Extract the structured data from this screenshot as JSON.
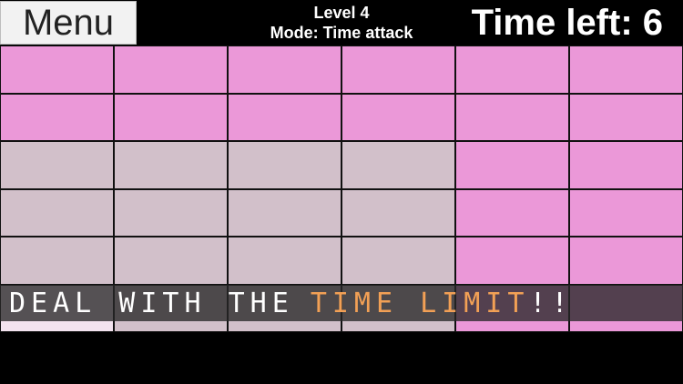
{
  "header": {
    "menu_label": "Menu",
    "level": "Level 4",
    "mode": "Mode: Time attack",
    "time_left": "Time left: 6"
  },
  "board": {
    "rows": 6,
    "cols": 6,
    "cells": [
      [
        "pink",
        "pink",
        "pink",
        "pink",
        "pink",
        "pink"
      ],
      [
        "pink",
        "pink",
        "pink",
        "pink",
        "pink",
        "pink"
      ],
      [
        "gray",
        "gray",
        "gray",
        "gray",
        "pink",
        "pink"
      ],
      [
        "gray",
        "gray",
        "gray",
        "gray",
        "pink",
        "pink"
      ],
      [
        "gray",
        "gray",
        "gray",
        "gray",
        "pink",
        "pink"
      ],
      [
        "light",
        "gray",
        "gray",
        "gray",
        "pink",
        "pink"
      ]
    ]
  },
  "banner": {
    "part1": "DEAL WITH THE",
    "part2": "TIME LIMIT",
    "part3": "!!"
  },
  "colors": {
    "pink": "#eb98d8",
    "gray": "#d2c0ca",
    "banner_highlight": "#f2a055"
  }
}
